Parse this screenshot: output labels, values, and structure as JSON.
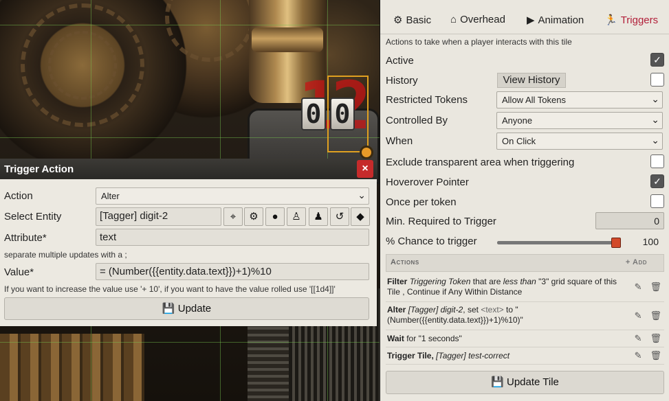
{
  "scene": {
    "big_digits": [
      "1",
      "2"
    ],
    "counter_digits": [
      "0",
      "0"
    ]
  },
  "dialog": {
    "title": "Trigger Action",
    "close": "×",
    "action_label": "Action",
    "action_value": "Alter",
    "entity_label": "Select Entity",
    "entity_value": "[Tagger] digit-2",
    "attribute_label": "Attribute*",
    "attribute_value": "text",
    "attribute_hint": "separate multiple updates with a ;",
    "value_label": "Value*",
    "value_value": "= (Number({{entity.data.text}})+1)%10",
    "value_hint": "If you want to increase the value use '+ 10', if you want to have the value rolled use '[[1d4]]'",
    "update_label": "Update"
  },
  "tabs": [
    {
      "label": "Basic",
      "icon": "cogs-icon"
    },
    {
      "label": "Overhead",
      "icon": "home-icon"
    },
    {
      "label": "Animation",
      "icon": "play-icon"
    },
    {
      "label": "Triggers",
      "icon": "running-icon"
    }
  ],
  "panel": {
    "subtitle": "Actions to take when a player interacts with this tile",
    "active_label": "Active",
    "history_label": "History",
    "view_history": "View History",
    "restricted_label": "Restricted Tokens",
    "restricted_value": "Allow All Tokens",
    "controlled_label": "Controlled By",
    "controlled_value": "Anyone",
    "when_label": "When",
    "when_value": "On Click",
    "exclude_label": "Exclude transparent area when triggering",
    "hover_label": "Hoverover Pointer",
    "once_label": "Once per token",
    "min_label": "Min. Required to Trigger",
    "min_value": "0",
    "chance_label": "% Chance to trigger",
    "chance_value": "100",
    "chance_fraction": 1.0,
    "active_checked": true,
    "history_checked": false,
    "exclude_checked": false,
    "hover_checked": true,
    "once_checked": false,
    "actions_header": "Actions",
    "add_label": "+ Add",
    "update_tile": "Update Tile"
  },
  "actions": [
    {
      "kw": "Filter",
      "p1": "Triggering Token",
      "p2": " that are ",
      "p3": "less than",
      "p4": " \"3\" grid square of this Tile , Continue if Any Within Distance"
    },
    {
      "kw": "Alter",
      "p1": "[Tagger] digit-2",
      "p2": ", set ",
      "p3": "<text>",
      "p4": " to \"(Number({{entity.data.text}})+1)%10)\""
    },
    {
      "kw": "Wait",
      "p1": "",
      "p2": " for \"1 seconds\"",
      "p3": "",
      "p4": ""
    },
    {
      "kw": "Trigger Tile,",
      "p1": " [Tagger] test-correct",
      "p2": "",
      "p3": "",
      "p4": ""
    }
  ]
}
